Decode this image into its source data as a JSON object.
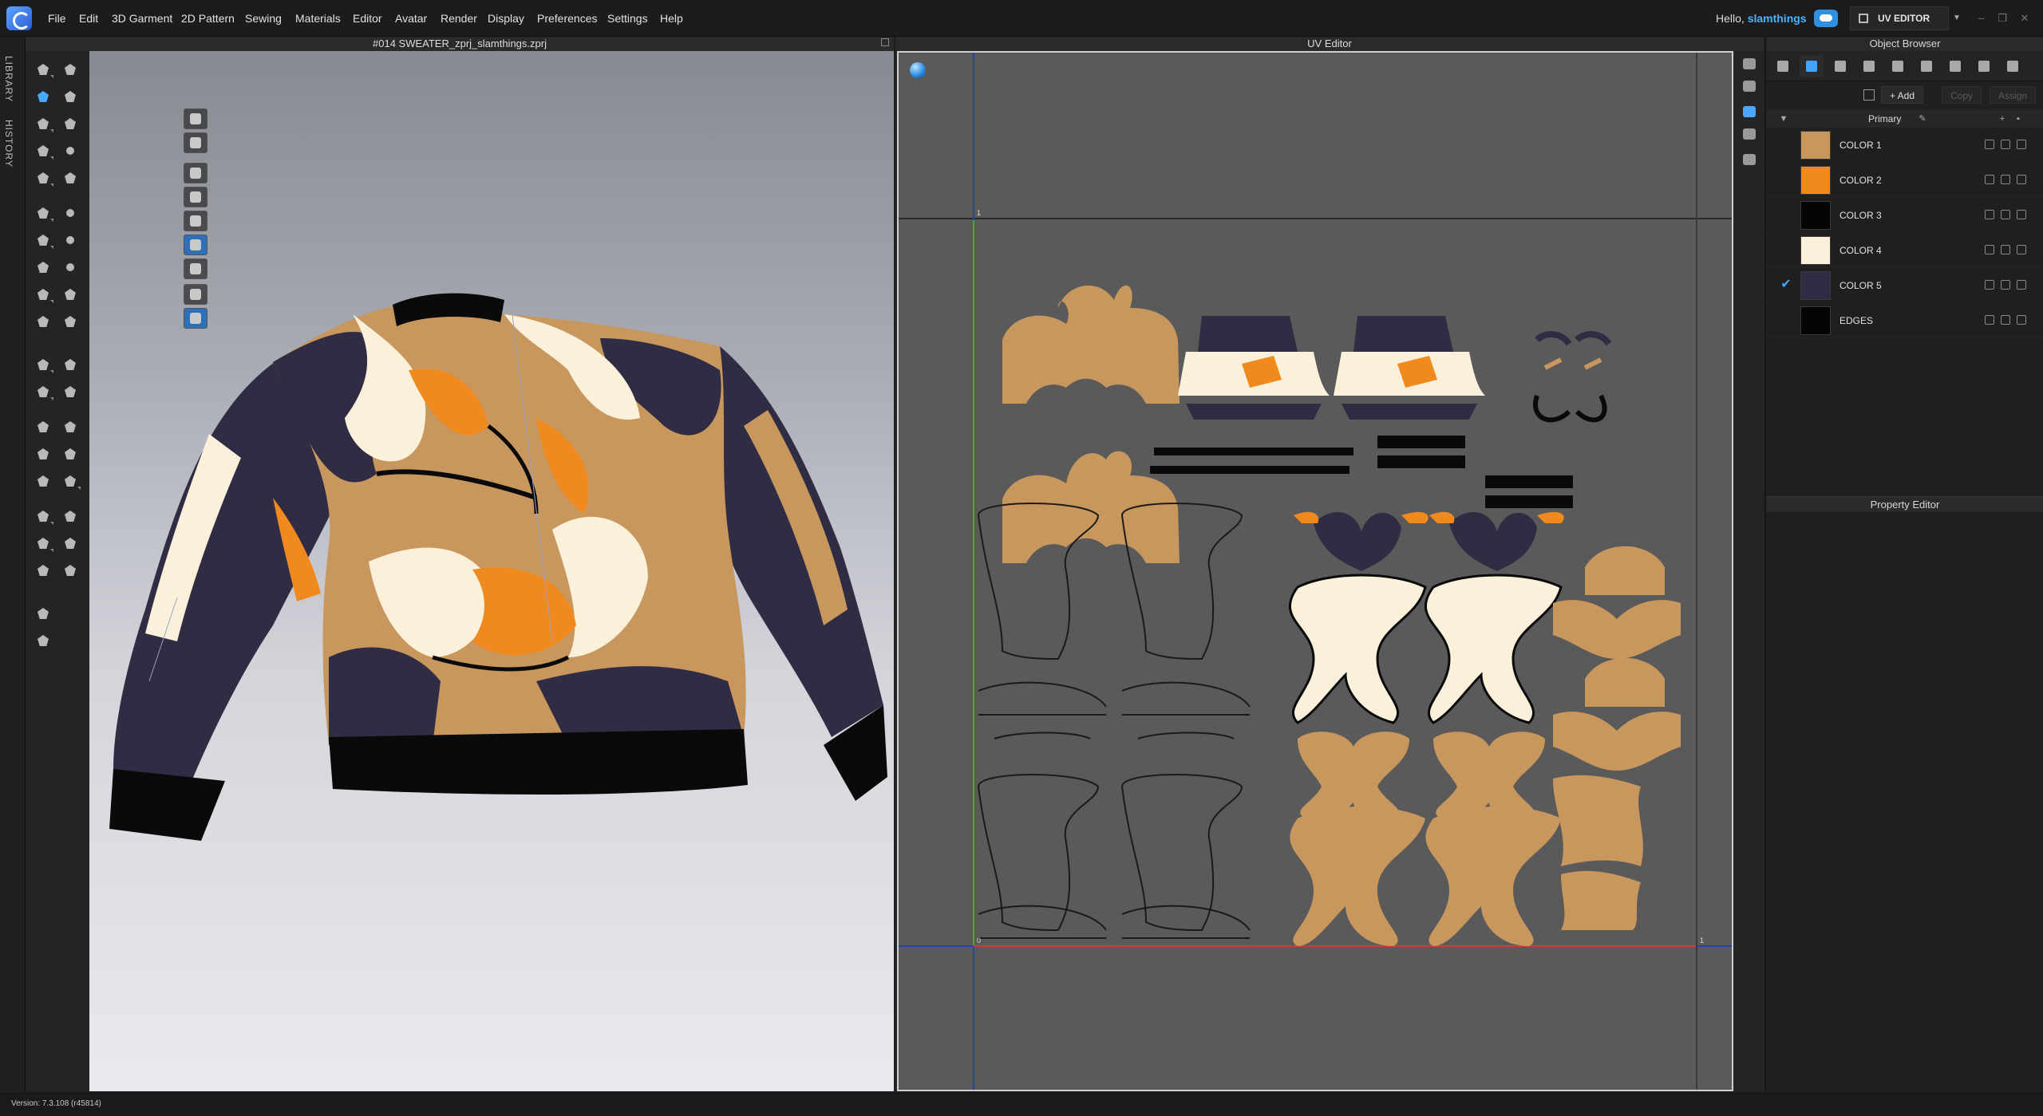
{
  "menu": [
    "File",
    "Edit",
    "3D Garment",
    "2D Pattern",
    "Sewing",
    "Materials",
    "Editor",
    "Avatar",
    "Render",
    "Display",
    "Preferences",
    "Settings",
    "Help"
  ],
  "header": {
    "greeting": "Hello, ",
    "username": "slamthings",
    "mode": "UV EDITOR"
  },
  "left_tabs": [
    "LIBRARY",
    "HISTORY"
  ],
  "viewport3d": {
    "title": "#014 SWEATER_zprj_slamthings.zprj"
  },
  "uv_editor": {
    "title": "UV Editor",
    "axis_labels": {
      "top_one": "1",
      "origin": "0",
      "right_one": "1"
    }
  },
  "object_browser": {
    "title": "Object Browser",
    "actions": {
      "add": "+ Add",
      "copy": "Copy",
      "assign": "Assign"
    },
    "colorway": "Primary",
    "materials": [
      {
        "name": "COLOR 1",
        "color": "#c8975e",
        "checked": false
      },
      {
        "name": "COLOR 2",
        "color": "#f08a1e",
        "checked": false
      },
      {
        "name": "COLOR 3",
        "color": "#050505",
        "checked": false
      },
      {
        "name": "COLOR 4",
        "color": "#fbf0da",
        "checked": false
      },
      {
        "name": "COLOR 5",
        "color": "#2f2c44",
        "checked": true
      },
      {
        "name": "EDGES",
        "color": "#050505",
        "checked": false
      }
    ]
  },
  "property_editor": {
    "title": "Property Editor"
  },
  "status": {
    "version": "Version: 7.3.108 (r45814)"
  },
  "colors": {
    "accent": "#42a5ff",
    "tan": "#c8975e",
    "orange": "#f08a1e",
    "cream": "#fbf0da",
    "navy": "#2f2c44",
    "black": "#0a0a0a"
  }
}
